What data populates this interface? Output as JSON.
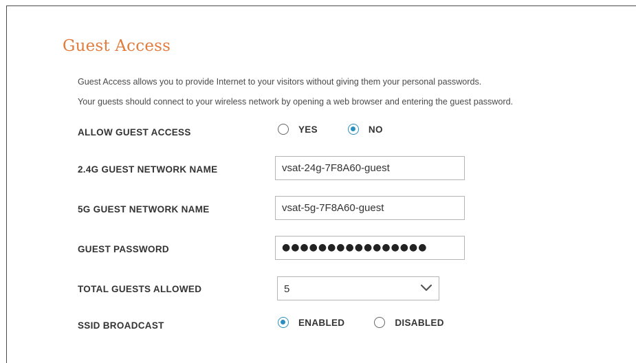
{
  "page": {
    "title": "Guest Access",
    "description_line1": "Guest Access allows you to provide Internet to your visitors without giving them your personal passwords.",
    "description_line2": "Your guests should connect to your wireless network by opening a web browser and entering the guest password."
  },
  "form": {
    "allow_guest_access": {
      "label": "ALLOW GUEST ACCESS",
      "options": [
        "YES",
        "NO"
      ],
      "selected": "NO"
    },
    "network_24g": {
      "label": "2.4G GUEST NETWORK NAME",
      "value": "vsat-24g-7F8A60-guest"
    },
    "network_5g": {
      "label": "5G GUEST NETWORK NAME",
      "value": "vsat-5g-7F8A60-guest"
    },
    "guest_password": {
      "label": "GUEST PASSWORD",
      "masked_value": "●●●●●●●●●●●●●●●●"
    },
    "total_guests": {
      "label": "TOTAL GUESTS ALLOWED",
      "value": "5"
    },
    "ssid_broadcast": {
      "label": "SSID BROADCAST",
      "options": [
        "ENABLED",
        "DISABLED"
      ],
      "selected": "ENABLED"
    }
  },
  "colors": {
    "title": "#e07c3e",
    "radio_selected": "#2a8fbd",
    "text": "#333333",
    "input_border": "#b5b5b5"
  },
  "icons": {
    "select_arrow": "chevron-down-icon"
  }
}
